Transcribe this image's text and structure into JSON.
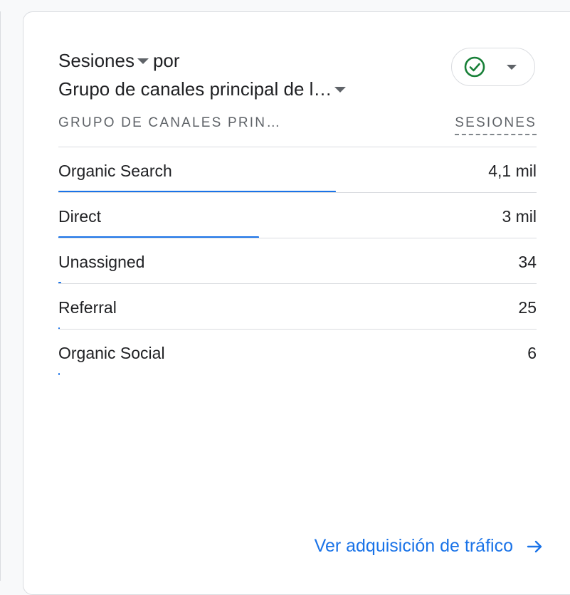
{
  "card": {
    "metric_label": "Sesiones",
    "by_label": "por",
    "dimension_label": "Grupo de canales principal de l…",
    "column_dimension": "GRUPO DE CANALES PRIN…",
    "column_metric": "SESIONES",
    "rows": [
      {
        "label": "Organic Search",
        "value": "4,1 mil",
        "share": 0.58
      },
      {
        "label": "Direct",
        "value": "3 mil",
        "share": 0.42
      },
      {
        "label": "Unassigned",
        "value": "34",
        "share": 0.006
      },
      {
        "label": "Referral",
        "value": "25",
        "share": 0.003
      },
      {
        "label": "Organic Social",
        "value": "6",
        "share": 0.002
      }
    ],
    "footer_link": "Ver adquisición de tráfico"
  },
  "colors": {
    "accent": "#1a73e8",
    "check": "#188038"
  },
  "icons": {
    "metric_dropdown": "caret-down-icon",
    "dimension_dropdown": "caret-down-icon",
    "status": "check-circle-icon",
    "footer": "arrow-right-icon"
  }
}
